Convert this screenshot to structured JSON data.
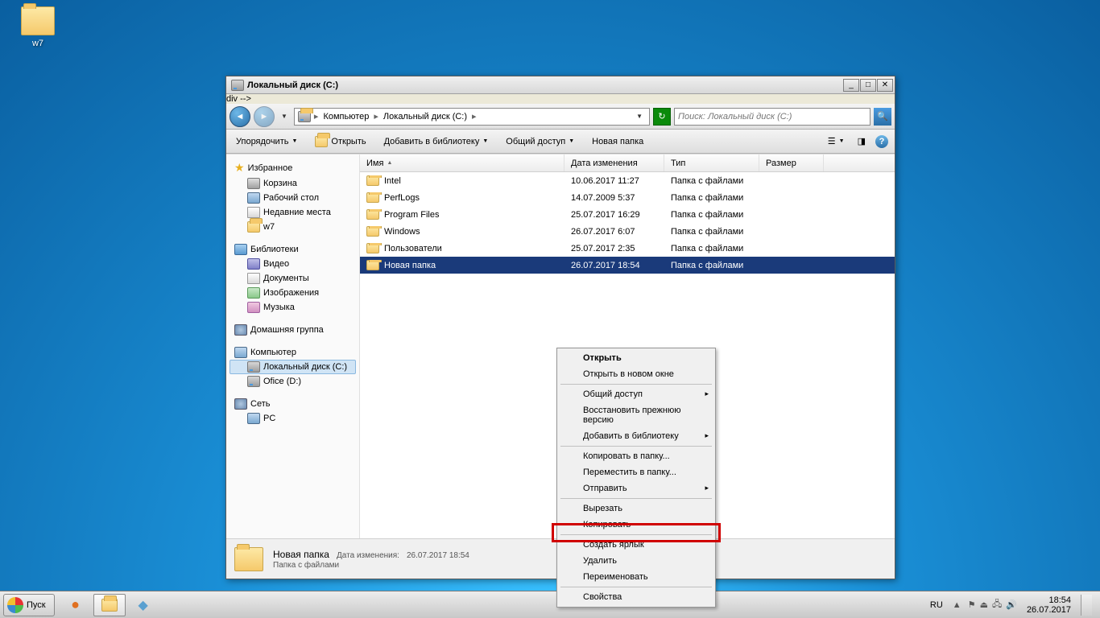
{
  "desktop": {
    "icon_label": "w7"
  },
  "window": {
    "title": "Локальный диск (C:)",
    "breadcrumb": {
      "root": "Компьютер",
      "current": "Локальный диск (C:)"
    },
    "search_placeholder": "Поиск: Локальный диск (C:)",
    "toolbar": {
      "organize": "Упорядочить",
      "open": "Открыть",
      "add_to_library": "Добавить в библиотеку",
      "share": "Общий доступ",
      "new_folder": "Новая папка"
    },
    "columns": {
      "name": "Имя",
      "date": "Дата изменения",
      "type": "Тип",
      "size": "Размер"
    }
  },
  "sidebar": {
    "favorites": {
      "label": "Избранное",
      "items": [
        "Корзина",
        "Рабочий стол",
        "Недавние места",
        "w7"
      ]
    },
    "libraries": {
      "label": "Библиотеки",
      "items": [
        "Видео",
        "Документы",
        "Изображения",
        "Музыка"
      ]
    },
    "homegroup": {
      "label": "Домашняя группа"
    },
    "computer": {
      "label": "Компьютер",
      "items": [
        "Локальный диск (C:)",
        "Ofice (D:)"
      ]
    },
    "network": {
      "label": "Сеть",
      "items": [
        "PC"
      ]
    }
  },
  "files": [
    {
      "name": "Intel",
      "date": "10.06.2017 11:27",
      "type": "Папка с файлами"
    },
    {
      "name": "PerfLogs",
      "date": "14.07.2009 5:37",
      "type": "Папка с файлами"
    },
    {
      "name": "Program Files",
      "date": "25.07.2017 16:29",
      "type": "Папка с файлами"
    },
    {
      "name": "Windows",
      "date": "26.07.2017 6:07",
      "type": "Папка с файлами"
    },
    {
      "name": "Пользователи",
      "date": "25.07.2017 2:35",
      "type": "Папка с файлами"
    },
    {
      "name": "Новая папка",
      "date": "26.07.2017 18:54",
      "type": "Папка с файлами",
      "selected": true
    }
  ],
  "context_menu": {
    "open": "Открыть",
    "open_new": "Открыть в новом окне",
    "share": "Общий доступ",
    "restore": "Восстановить прежнюю версию",
    "add_lib": "Добавить в библиотеку",
    "copy_to": "Копировать в папку...",
    "move_to": "Переместить в папку...",
    "send_to": "Отправить",
    "cut": "Вырезать",
    "copy": "Копировать",
    "shortcut": "Создать ярлык",
    "delete": "Удалить",
    "rename": "Переименовать",
    "properties": "Свойства"
  },
  "details": {
    "name": "Новая папка",
    "sub": "Папка с файлами",
    "meta_label": "Дата изменения:",
    "meta_value": "26.07.2017 18:54"
  },
  "taskbar": {
    "start": "Пуск",
    "lang": "RU",
    "time": "18:54",
    "date": "26.07.2017"
  }
}
